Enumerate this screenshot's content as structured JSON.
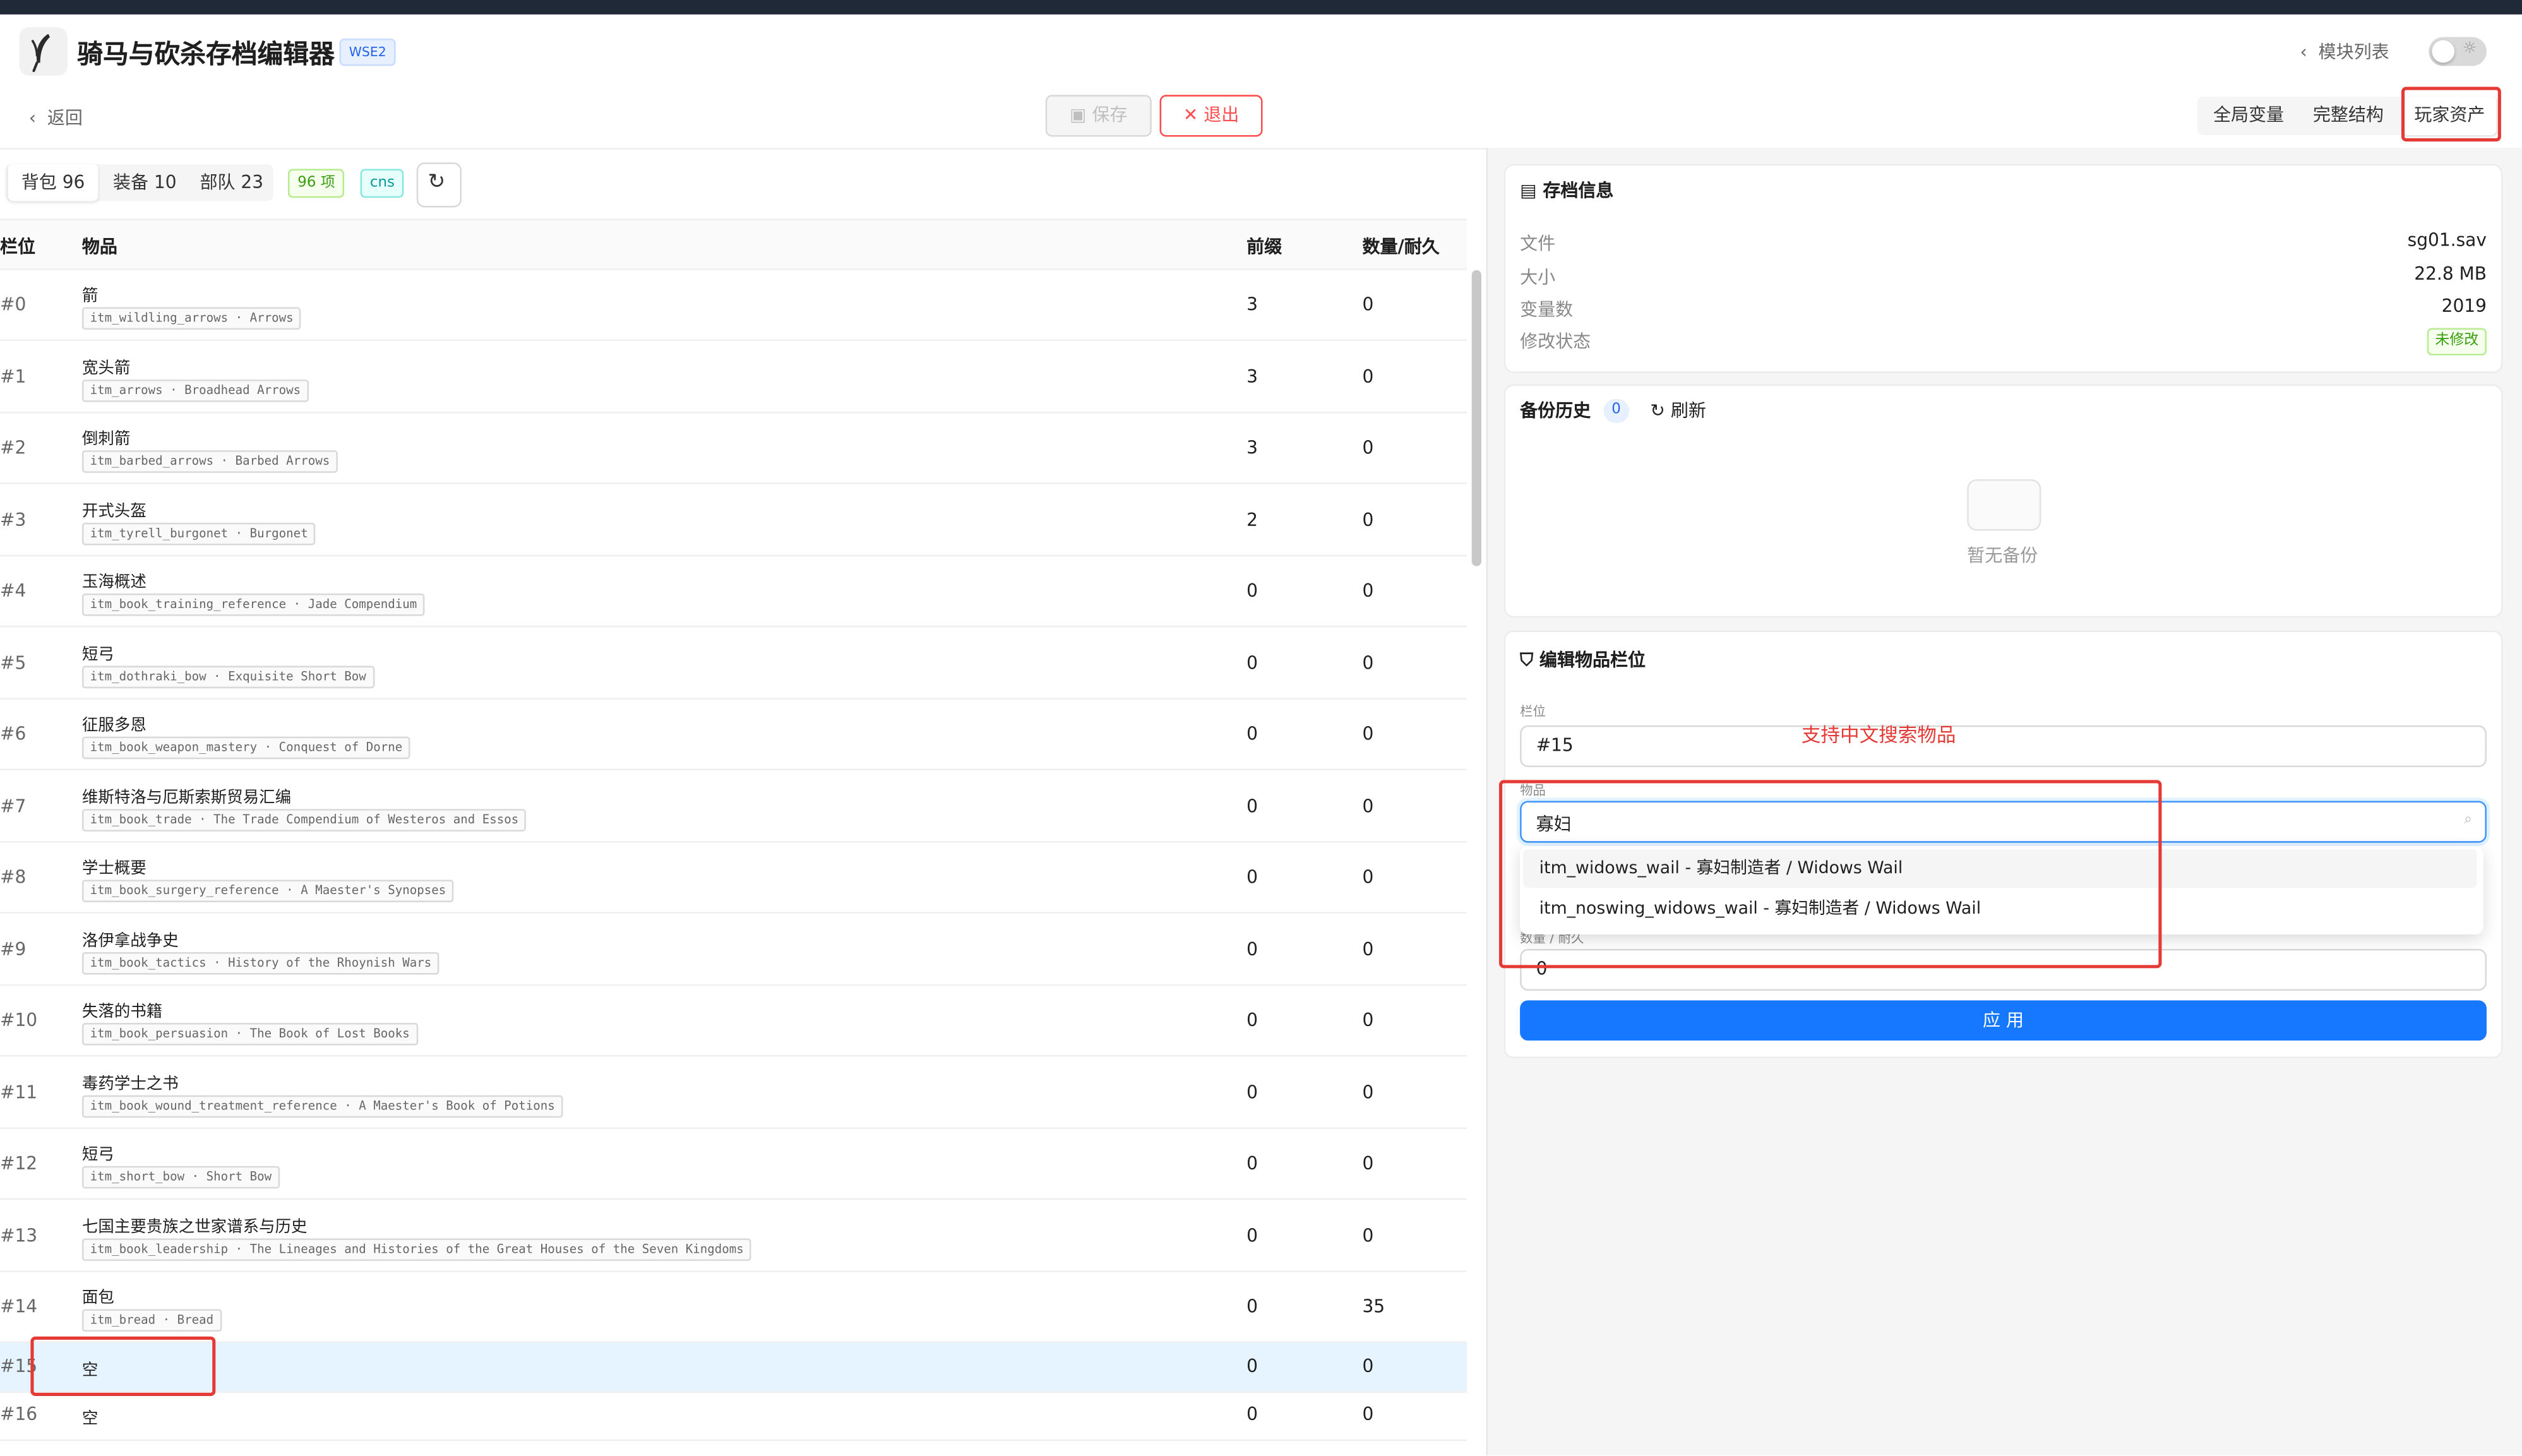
{
  "app": {
    "title": "骑马与砍杀存档编辑器",
    "badge": "WSE2",
    "module_list_label": "模块列表",
    "back_label": "返回",
    "save_label": "保存",
    "exit_label": "退出",
    "icons": {
      "logo": "feather-logo",
      "back": "chevron-left-icon",
      "save": "save-icon",
      "exit": "close-icon",
      "theme": "sun-icon",
      "refresh": "refresh-icon",
      "search": "search-icon"
    }
  },
  "view_tabs": [
    {
      "label": "全局变量",
      "active": false
    },
    {
      "label": "完整结构",
      "active": false
    },
    {
      "label": "玩家资产",
      "active": true
    }
  ],
  "inventory": {
    "tabs": [
      {
        "label": "背包 96",
        "active": true
      },
      {
        "label": "装备 10",
        "active": false
      },
      {
        "label": "部队 23",
        "active": false
      }
    ],
    "count_tag": "96 项",
    "mode_tag": "cns",
    "columns": {
      "slot": "栏位",
      "item": "物品",
      "prefix": "前缀",
      "qty": "数量/耐久"
    },
    "rows": [
      {
        "slot": "#0",
        "name": "箭",
        "code": "itm_wildling_arrows · Arrows",
        "prefix": "3",
        "qty": "0"
      },
      {
        "slot": "#1",
        "name": "宽头箭",
        "code": "itm_arrows · Broadhead Arrows",
        "prefix": "3",
        "qty": "0"
      },
      {
        "slot": "#2",
        "name": "倒刺箭",
        "code": "itm_barbed_arrows · Barbed Arrows",
        "prefix": "3",
        "qty": "0"
      },
      {
        "slot": "#3",
        "name": "开式头盔",
        "code": "itm_tyrell_burgonet · Burgonet",
        "prefix": "2",
        "qty": "0"
      },
      {
        "slot": "#4",
        "name": "玉海概述",
        "code": "itm_book_training_reference · Jade Compendium",
        "prefix": "0",
        "qty": "0"
      },
      {
        "slot": "#5",
        "name": "短弓",
        "code": "itm_dothraki_bow · Exquisite Short Bow",
        "prefix": "0",
        "qty": "0"
      },
      {
        "slot": "#6",
        "name": "征服多恩",
        "code": "itm_book_weapon_mastery · Conquest of Dorne",
        "prefix": "0",
        "qty": "0"
      },
      {
        "slot": "#7",
        "name": "维斯特洛与厄斯索斯贸易汇编",
        "code": "itm_book_trade · The Trade Compendium of Westeros and Essos",
        "prefix": "0",
        "qty": "0"
      },
      {
        "slot": "#8",
        "name": "学士概要",
        "code": "itm_book_surgery_reference · A Maester's Synopses",
        "prefix": "0",
        "qty": "0"
      },
      {
        "slot": "#9",
        "name": "洛伊拿战争史",
        "code": "itm_book_tactics · History of the Rhoynish Wars",
        "prefix": "0",
        "qty": "0"
      },
      {
        "slot": "#10",
        "name": "失落的书籍",
        "code": "itm_book_persuasion · The Book of Lost Books",
        "prefix": "0",
        "qty": "0"
      },
      {
        "slot": "#11",
        "name": "毒药学士之书",
        "code": "itm_book_wound_treatment_reference · A Maester's Book of Potions",
        "prefix": "0",
        "qty": "0"
      },
      {
        "slot": "#12",
        "name": "短弓",
        "code": "itm_short_bow · Short Bow",
        "prefix": "0",
        "qty": "0"
      },
      {
        "slot": "#13",
        "name": "七国主要贵族之世家谱系与历史",
        "code": "itm_book_leadership · The Lineages and Histories of the Great Houses of the Seven Kingdoms",
        "prefix": "0",
        "qty": "0"
      },
      {
        "slot": "#14",
        "name": "面包",
        "code": "itm_bread · Bread",
        "prefix": "0",
        "qty": "35"
      },
      {
        "slot": "#15",
        "name": "空",
        "code": "",
        "prefix": "0",
        "qty": "0",
        "selected": true
      },
      {
        "slot": "#16",
        "name": "空",
        "code": "",
        "prefix": "0",
        "qty": "0"
      }
    ]
  },
  "save_info": {
    "title": "存档信息",
    "rows": [
      {
        "label": "文件",
        "value": "sg01.sav"
      },
      {
        "label": "大小",
        "value": "22.8 MB"
      },
      {
        "label": "变量数",
        "value": "2019"
      }
    ],
    "status_label": "修改状态",
    "status_value": "未修改"
  },
  "backup": {
    "title": "备份历史",
    "count": "0",
    "refresh_label": "刷新",
    "empty_text": "暂无备份"
  },
  "edit_slot": {
    "title": "编辑物品栏位",
    "slot_label": "栏位",
    "slot_value": "#15",
    "item_label": "物品",
    "item_query": "寡妇",
    "options": [
      "itm_widows_wail - 寡妇制造者 / Widows Wail",
      "itm_noswing_widows_wail - 寡妇制造者 / Widows Wail"
    ],
    "qty_label": "数量 / 耐久",
    "qty_value": "0",
    "apply_label": "应 用"
  },
  "annotation": {
    "text": "支持中文搜索物品",
    "color": "#e53935"
  },
  "colors": {
    "primary": "#1677ff",
    "danger": "#ff4d4f",
    "success": "#389e0d",
    "selected_row": "#e6f4ff"
  }
}
